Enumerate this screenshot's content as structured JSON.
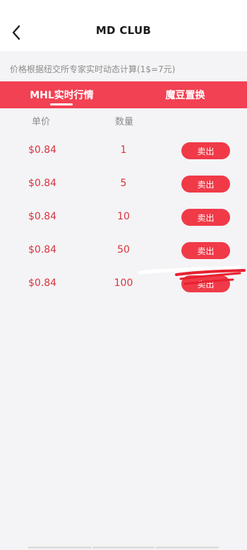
{
  "header": {
    "title": "MD CLUB",
    "back_icon": "chevron-left-icon"
  },
  "notice": "价格根据纽交所专家实时动态计算(1$=7元)",
  "tabs": [
    {
      "label": "MHL实时行情",
      "active": true
    },
    {
      "label": "魔豆置换",
      "active": false
    }
  ],
  "table": {
    "columns": {
      "price": "单价",
      "quantity": "数量"
    },
    "rows": [
      {
        "price": "$0.84",
        "quantity": "1",
        "action": "卖出"
      },
      {
        "price": "$0.84",
        "quantity": "5",
        "action": "卖出"
      },
      {
        "price": "$0.84",
        "quantity": "10",
        "action": "卖出"
      },
      {
        "price": "$0.84",
        "quantity": "50",
        "action": "卖出"
      },
      {
        "price": "$0.84",
        "quantity": "100",
        "action": "卖出"
      }
    ]
  },
  "colors": {
    "accent": "#f24152",
    "button": "#f03a48",
    "value_text": "#d9343f",
    "muted_text": "#8c8c8c",
    "background": "#f4f4f6"
  }
}
